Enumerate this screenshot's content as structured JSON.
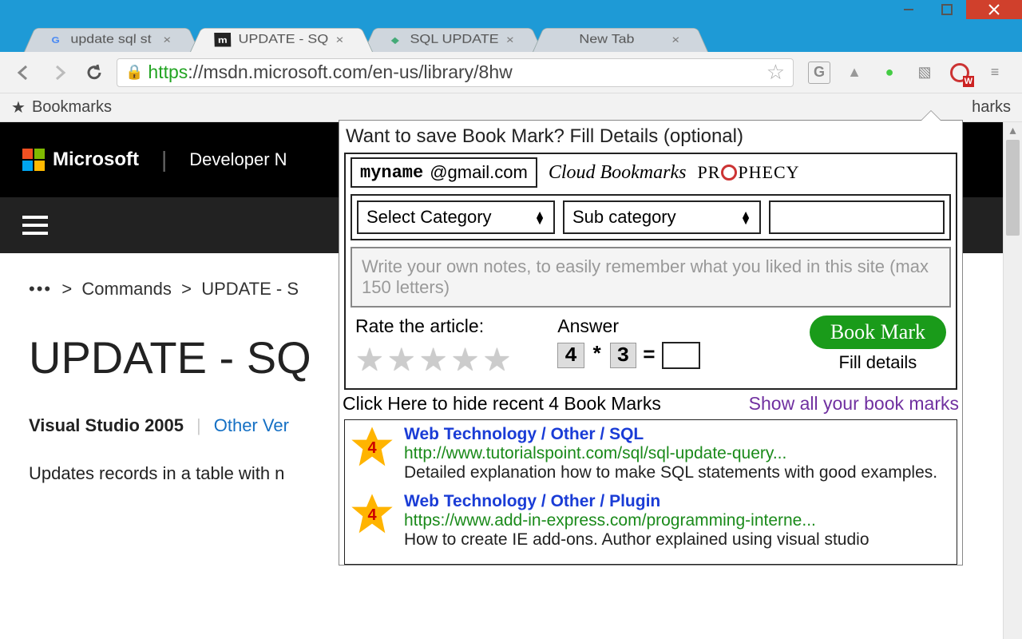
{
  "tabs": [
    {
      "label": "update sql st",
      "active": false
    },
    {
      "label": "UPDATE - SQ",
      "active": true
    },
    {
      "label": "SQL UPDATE",
      "active": false
    },
    {
      "label": "New Tab",
      "active": false
    }
  ],
  "url_https": "https",
  "url_rest": "://msdn.microsoft.com/en-us/library/8hw",
  "bookmarks_label": "Bookmarks",
  "other_bookmarks": "harks",
  "ms": {
    "brand": "Microsoft",
    "dev": "Developer N"
  },
  "breadcrumb": {
    "dots": "•••",
    "a": "Commands",
    "b": "UPDATE - S"
  },
  "page_title": "UPDATE - SQ",
  "vs_label": "Visual Studio 2005",
  "other_ver": "Other Ver",
  "desc": "Updates records in a table with n",
  "popup": {
    "title": "Want to save Book Mark? Fill Details (optional)",
    "email_name": "myname",
    "email_domain": "@gmail.com",
    "cloud_label": "Cloud Bookmarks",
    "brand_a": "PR",
    "brand_b": "PHECY",
    "cat": "Select Category",
    "subcat": "Sub category",
    "notes_placeholder": "Write your own notes, to easily remember what you liked in this site (max 150 letters)",
    "rate_label": "Rate the article:",
    "answer_label": "Answer",
    "captcha_a": "4",
    "captcha_op": "*",
    "captcha_b": "3",
    "captcha_eq": "=",
    "bookmark_btn": "Book Mark",
    "fill_details": "Fill details",
    "hide_recent": "Click Here to hide  recent 4 Book Marks",
    "show_all": "Show all your book marks",
    "items": [
      {
        "rating": "4",
        "cat": "Web Technology / Other / SQL",
        "url": "http://www.tutorialspoint.com/sql/sql-update-query...",
        "desc": "Detailed explanation how to make SQL statements with good examples."
      },
      {
        "rating": "4",
        "cat": "Web Technology / Other / Plugin",
        "url": "https://www.add-in-express.com/programming-interne...",
        "desc": "How to create IE add-ons. Author explained using visual studio"
      }
    ]
  }
}
